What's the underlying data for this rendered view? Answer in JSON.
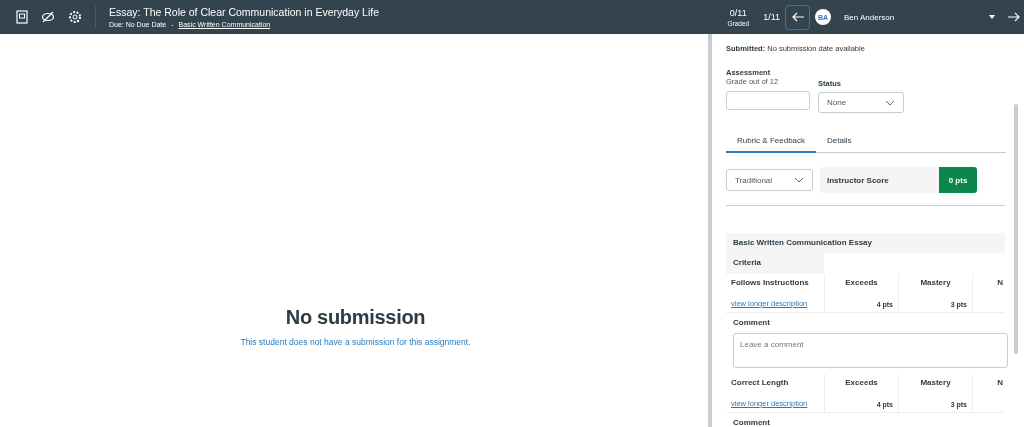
{
  "header": {
    "title": "Essay: The Role of Clear Communication in Everyday Life",
    "due": "Due: No Due Date",
    "separator": "-",
    "course_link": "Basic Written Communication",
    "graded_count": "0/11",
    "graded_label": "Graded",
    "position": "1/11",
    "student_initials": "BA",
    "student_name": "Ben Anderson"
  },
  "submission": {
    "heading": "No submission",
    "message": "This student does not have a submission for this assignment."
  },
  "sidebar": {
    "submitted_label": "Submitted:",
    "submitted_value": "No submission date available",
    "assessment_label": "Assessment",
    "assessment_hint": "Grade out of 12",
    "status_label": "Status",
    "status_value": "None",
    "tabs": [
      {
        "label": "Rubric & Feedback",
        "selected": true
      },
      {
        "label": "Details",
        "selected": false
      }
    ],
    "rubric_type": "Traditional",
    "score_label": "Instructor Score",
    "score_value": "0 pts",
    "rubric": {
      "title": "Basic Written Communication Essay",
      "criteria_header": "Criteria",
      "criteria": [
        {
          "name": "Follows Instructions",
          "link": "view longer description",
          "ratings": [
            {
              "label": "Exceeds",
              "points": "4 pts"
            },
            {
              "label": "Mastery",
              "points": "3 pts"
            },
            {
              "label": "N"
            }
          ],
          "comment_label": "Comment",
          "comment_placeholder": "Leave a comment"
        },
        {
          "name": "Correct Length",
          "link": "view longer description",
          "ratings": [
            {
              "label": "Exceeds",
              "points": "4 pts"
            },
            {
              "label": "Mastery",
              "points": "3 pts"
            },
            {
              "label": "N"
            }
          ],
          "comment_label": "Comment"
        }
      ]
    }
  }
}
